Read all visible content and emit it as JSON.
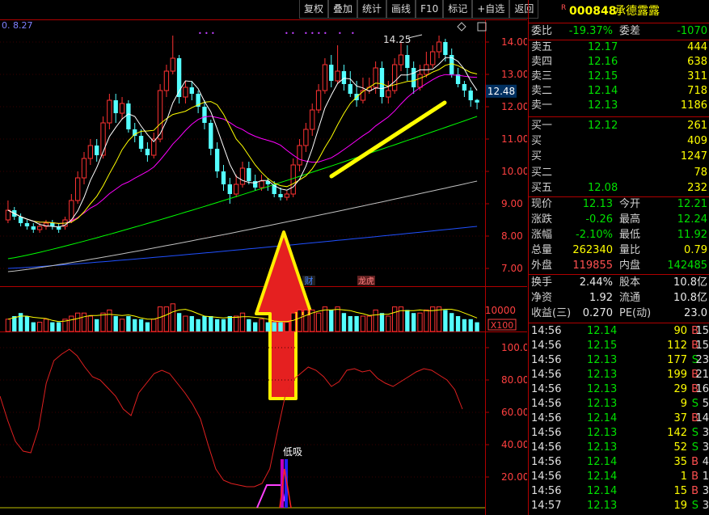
{
  "toolbar": {
    "buttons": [
      "复权",
      "叠加",
      "统计",
      "画线",
      "F10",
      "标记",
      "+自选",
      "返回"
    ],
    "settings_icon": "diamond-settings-icon",
    "grid_icon": "grid-layout-icon"
  },
  "stock": {
    "r_mark": "R",
    "code": "000848",
    "name": "承德露露",
    "current_price_tag": "12.48"
  },
  "chart_text": {
    "top_left_label": "0. 8.27",
    "high_marker": "14.25",
    "event_cai": "财",
    "event_longhu": "龙虎",
    "vol_unit": "X100",
    "vol_axis": "10000",
    "signal_label": "低吸"
  },
  "colors": {
    "up": "#ff3232",
    "down": "#54ffff",
    "ma5": "#ffffff",
    "ma10": "#ffff00",
    "ma20": "#ff00ff",
    "ma60": "#00ff00",
    "ma120": "#c0c0c0",
    "ma250": "#2050ff",
    "annotation_line": "#ffff00",
    "arrow_fill": "#e52020",
    "arrow_border": "#ffee00",
    "oscillator": "#e02020"
  },
  "quote": {
    "webi_label": "委比",
    "webi_value": "-19.37%",
    "weicha_label": "委差",
    "weicha_value": "-1070",
    "asks": [
      {
        "label": "卖五",
        "price": "12.17",
        "vol": "444"
      },
      {
        "label": "卖四",
        "price": "12.16",
        "vol": "638"
      },
      {
        "label": "卖三",
        "price": "12.15",
        "vol": "311"
      },
      {
        "label": "卖二",
        "price": "12.14",
        "vol": "718"
      },
      {
        "label": "卖一",
        "price": "12.13",
        "vol": "1186"
      }
    ],
    "bids": [
      {
        "label": "买一",
        "price": "12.12",
        "vol": "261"
      },
      {
        "label": "买",
        "price": "",
        "vol": "409"
      },
      {
        "label": "买",
        "price": "",
        "vol": "1247"
      },
      {
        "label": "买二",
        "price": "",
        "vol": "78"
      },
      {
        "label": "买五",
        "price": "12.08",
        "vol": "232"
      }
    ],
    "stats": [
      {
        "l1": "现价",
        "v1": "12.13",
        "c1": "green",
        "l2": "今开",
        "v2": "12.21",
        "c2": "green"
      },
      {
        "l1": "涨跌",
        "v1": "-0.26",
        "c1": "green",
        "l2": "最高",
        "v2": "12.24",
        "c2": "green"
      },
      {
        "l1": "涨幅",
        "v1": "-2.10%",
        "c1": "green",
        "l2": "最低",
        "v2": "11.92",
        "c2": "green"
      },
      {
        "l1": "总量",
        "v1": "262340",
        "c1": "yellow",
        "l2": "量比",
        "v2": "0.79",
        "c2": "yellow"
      },
      {
        "l1": "外盘",
        "v1": "119855",
        "c1": "red",
        "l2": "内盘",
        "v2": "142485",
        "c2": "green"
      }
    ],
    "fundamentals": [
      {
        "l1": "换手",
        "v1": "2.44%",
        "l2": "股本",
        "v2": "10.8亿"
      },
      {
        "l1": "净资",
        "v1": "1.92",
        "l2": "流通",
        "v2": "10.8亿"
      },
      {
        "l1": "收益(三)",
        "v1": "0.270",
        "l2": "PE(动)",
        "v2": "23.0"
      }
    ],
    "ticks": [
      {
        "time": "14:56",
        "price": "12.14",
        "vol": "90",
        "dir": "B",
        "n": "15"
      },
      {
        "time": "14:56",
        "price": "12.15",
        "vol": "112",
        "dir": "B",
        "n": "15"
      },
      {
        "time": "14:56",
        "price": "12.13",
        "vol": "177",
        "dir": "S",
        "n": "23"
      },
      {
        "time": "14:56",
        "price": "12.13",
        "vol": "199",
        "dir": "B",
        "n": "21"
      },
      {
        "time": "14:56",
        "price": "12.13",
        "vol": "29",
        "dir": "B",
        "n": "16"
      },
      {
        "time": "14:56",
        "price": "12.13",
        "vol": "9",
        "dir": "S",
        "n": "5"
      },
      {
        "time": "14:56",
        "price": "12.14",
        "vol": "37",
        "dir": "B",
        "n": "14"
      },
      {
        "time": "14:56",
        "price": "12.13",
        "vol": "142",
        "dir": "S",
        "n": "3"
      },
      {
        "time": "14:56",
        "price": "12.13",
        "vol": "52",
        "dir": "S",
        "n": "3"
      },
      {
        "time": "14:56",
        "price": "12.14",
        "vol": "35",
        "dir": "B",
        "n": "4"
      },
      {
        "time": "14:56",
        "price": "12.14",
        "vol": "1",
        "dir": "B",
        "n": "1"
      },
      {
        "time": "14:56",
        "price": "12.14",
        "vol": "15",
        "dir": "B",
        "n": "3"
      },
      {
        "time": "14:57",
        "price": "12.13",
        "vol": "19",
        "dir": "S",
        "n": "3"
      }
    ]
  },
  "chart_data": [
    {
      "type": "candlestick",
      "panel": "price",
      "y_ticks": [
        "14.00",
        "13.00",
        "12.00",
        "11.00",
        "10.00",
        "9.00",
        "8.00",
        "7.00"
      ],
      "ylim": [
        6.5,
        14.6
      ],
      "candles": [
        [
          8.5,
          8.8,
          9.1,
          8.4
        ],
        [
          8.8,
          8.6,
          8.9,
          8.5
        ],
        [
          8.6,
          8.4,
          8.7,
          8.3
        ],
        [
          8.4,
          8.3,
          8.5,
          8.2
        ],
        [
          8.3,
          8.2,
          8.4,
          8.1
        ],
        [
          8.2,
          8.3,
          8.4,
          8.1
        ],
        [
          8.3,
          8.4,
          8.5,
          8.2
        ],
        [
          8.4,
          8.3,
          8.5,
          8.2
        ],
        [
          8.3,
          8.2,
          8.4,
          8.1
        ],
        [
          8.3,
          8.5,
          8.6,
          8.2
        ],
        [
          8.5,
          9.1,
          9.3,
          8.4
        ],
        [
          9.1,
          9.8,
          10.0,
          9.0
        ],
        [
          9.8,
          10.4,
          10.6,
          9.6
        ],
        [
          10.4,
          10.8,
          11.0,
          10.2
        ],
        [
          10.8,
          10.5,
          11.0,
          10.3
        ],
        [
          10.5,
          11.5,
          11.7,
          10.4
        ],
        [
          11.5,
          12.2,
          12.4,
          11.3
        ],
        [
          12.2,
          11.8,
          12.4,
          11.5
        ],
        [
          11.8,
          12.1,
          12.3,
          11.6
        ],
        [
          12.1,
          11.3,
          12.2,
          11.2
        ],
        [
          11.3,
          11.1,
          11.5,
          10.9
        ],
        [
          11.1,
          10.7,
          11.3,
          10.6
        ],
        [
          10.7,
          10.5,
          10.9,
          10.3
        ],
        [
          10.5,
          11.0,
          11.2,
          10.4
        ],
        [
          11.0,
          12.5,
          12.7,
          10.9
        ],
        [
          12.5,
          13.1,
          13.3,
          12.3
        ],
        [
          13.1,
          13.5,
          14.2,
          13.0
        ],
        [
          13.5,
          12.3,
          13.6,
          12.1
        ],
        [
          12.3,
          12.6,
          12.8,
          12.1
        ],
        [
          12.6,
          12.4,
          12.8,
          12.2
        ],
        [
          12.4,
          12.0,
          12.5,
          11.8
        ],
        [
          12.0,
          11.5,
          12.2,
          11.3
        ],
        [
          11.5,
          10.7,
          11.6,
          10.5
        ],
        [
          10.7,
          10.0,
          10.9,
          9.8
        ],
        [
          10.0,
          9.6,
          10.2,
          9.4
        ],
        [
          9.6,
          9.3,
          9.8,
          9.0
        ],
        [
          9.3,
          9.6,
          9.9,
          9.2
        ],
        [
          9.6,
          10.1,
          10.3,
          9.5
        ],
        [
          10.1,
          9.7,
          10.3,
          9.6
        ],
        [
          9.7,
          9.5,
          9.9,
          9.4
        ],
        [
          9.5,
          9.7,
          9.9,
          9.4
        ],
        [
          9.7,
          9.6,
          9.8,
          9.4
        ],
        [
          9.6,
          9.3,
          9.7,
          9.2
        ],
        [
          9.3,
          9.2,
          9.5,
          9.1
        ],
        [
          9.2,
          9.3,
          9.4,
          9.1
        ],
        [
          9.3,
          10.2,
          10.4,
          9.2
        ],
        [
          10.2,
          10.8,
          11.0,
          10.0
        ],
        [
          10.8,
          11.3,
          11.5,
          10.6
        ],
        [
          11.3,
          11.9,
          12.1,
          11.1
        ],
        [
          11.9,
          12.5,
          12.7,
          11.8
        ],
        [
          12.5,
          13.3,
          13.5,
          12.4
        ],
        [
          13.3,
          12.8,
          13.6,
          12.6
        ],
        [
          12.8,
          13.1,
          13.9,
          12.7
        ],
        [
          13.1,
          12.7,
          13.3,
          12.5
        ],
        [
          12.7,
          12.4,
          13.1,
          12.3
        ],
        [
          12.4,
          12.2,
          12.8,
          12.0
        ],
        [
          12.2,
          12.5,
          12.9,
          12.1
        ],
        [
          12.5,
          12.6,
          12.9,
          12.4
        ],
        [
          12.6,
          13.2,
          13.4,
          12.4
        ],
        [
          13.2,
          12.3,
          13.4,
          12.1
        ],
        [
          12.3,
          12.5,
          12.8,
          12.1
        ],
        [
          12.5,
          13.3,
          13.5,
          12.4
        ],
        [
          13.3,
          13.6,
          14.0,
          13.1
        ],
        [
          13.6,
          13.2,
          13.9,
          12.8
        ],
        [
          13.2,
          12.6,
          13.4,
          12.4
        ],
        [
          12.6,
          13.0,
          13.3,
          12.5
        ],
        [
          13.0,
          13.3,
          13.7,
          12.9
        ],
        [
          13.3,
          13.7,
          13.9,
          13.2
        ],
        [
          13.7,
          14.0,
          14.2,
          13.5
        ],
        [
          14.0,
          13.6,
          14.1,
          13.4
        ],
        [
          13.6,
          13.0,
          13.8,
          12.9
        ],
        [
          13.0,
          12.7,
          13.2,
          12.6
        ],
        [
          12.7,
          12.5,
          12.8,
          12.3
        ],
        [
          12.5,
          12.2,
          12.6,
          12.0
        ],
        [
          12.21,
          12.13,
          12.24,
          11.92
        ]
      ],
      "ma_last": {
        "MA60": 11.7,
        "MA120": 9.7,
        "MA250": 8.3
      },
      "annotation_line": {
        "from": 10.0,
        "to": 12.0
      }
    },
    {
      "type": "bar",
      "panel": "volume",
      "ylabel": "X100",
      "values": [
        4,
        5,
        6,
        5,
        3,
        3,
        4,
        3,
        3,
        4,
        5,
        6,
        6,
        5,
        4,
        6,
        7,
        5,
        4,
        5,
        4,
        4,
        3,
        4,
        8,
        8,
        9,
        6,
        5,
        5,
        4,
        5,
        5,
        4,
        4,
        5,
        5,
        6,
        4,
        3,
        4,
        3,
        3,
        3,
        3,
        6,
        7,
        7,
        7,
        6,
        8,
        7,
        8,
        6,
        5,
        5,
        5,
        5,
        7,
        6,
        5,
        8,
        8,
        7,
        6,
        6,
        7,
        8,
        8,
        7,
        6,
        5,
        4,
        4,
        3
      ]
    },
    {
      "type": "line",
      "panel": "oscillator",
      "y_ticks": [
        "100.0",
        "80.00",
        "60.00",
        "40.00",
        "20.00"
      ],
      "ylim": [
        0,
        105
      ],
      "values": [
        70,
        55,
        42,
        36,
        35,
        50,
        78,
        92,
        96,
        99,
        95,
        88,
        82,
        80,
        75,
        70,
        62,
        58,
        72,
        78,
        84,
        86,
        84,
        78,
        72,
        65,
        56,
        40,
        25,
        18,
        16,
        15,
        14,
        14,
        16,
        25,
        48,
        70,
        80,
        84,
        88,
        86,
        82,
        76,
        79,
        86,
        87,
        85,
        86,
        81,
        78,
        76,
        79,
        82,
        85,
        87,
        86,
        83,
        80,
        74,
        62
      ],
      "signal": {
        "label": "低吸"
      }
    }
  ]
}
